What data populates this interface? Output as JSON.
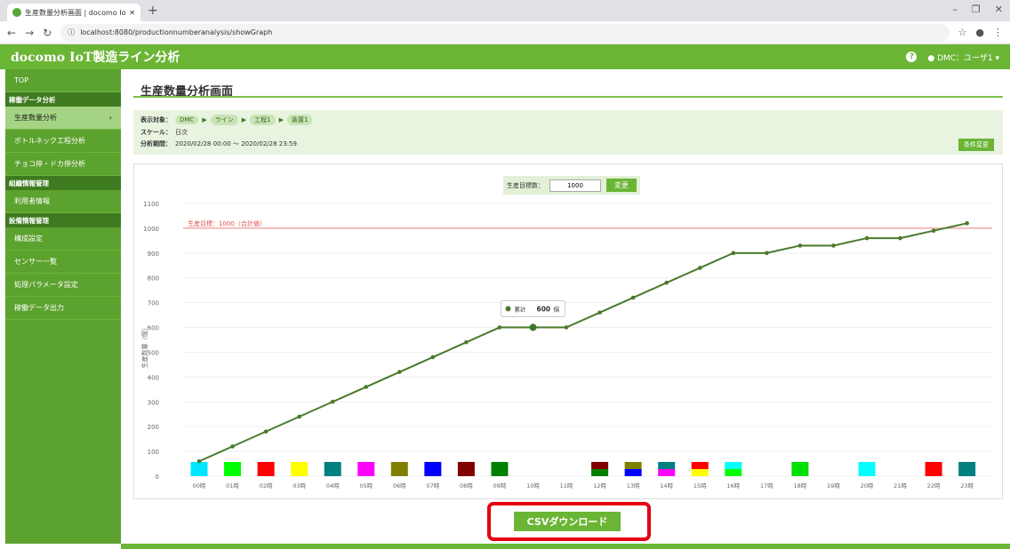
{
  "browser": {
    "tab_title": "生産数量分析画面 | docomo IoT",
    "url": "localhost:8080/productionnumberanalysis/showGraph"
  },
  "header": {
    "title": "docomo IoT製造ライン分析",
    "user": "DMC：ユーザ1"
  },
  "sidebar": {
    "top": "TOP",
    "sec_analysis": "稼働データ分析",
    "item_production": "生産数量分析",
    "item_bottleneck": "ボトルネック工程分析",
    "item_choko": "チョコ停・ドカ停分析",
    "sec_org": "組織情報管理",
    "item_users": "利用者情報",
    "sec_equipment": "設備情報管理",
    "item_config": "構成設定",
    "item_sensors": "センサー一覧",
    "item_params": "処理パラメータ設定",
    "item_output": "稼働データ出力"
  },
  "page": {
    "title": "生産数量分析画面",
    "target_label": "表示対象：",
    "breadcrumb": [
      "DMC",
      "ライン",
      "工程1",
      "装置1"
    ],
    "scale_label": "スケール：",
    "scale_value": "日次",
    "period_label": "分析期間：",
    "period_value": "2020/02/28 00:00 ～ 2020/02/28 23:59",
    "condition_button": "条件変更",
    "goal_label": "生産目標数：",
    "goal_value": "1000",
    "change_button": "変更",
    "csv_button": "CSVダウンロード"
  },
  "colors": {
    "accent": "#6bb535",
    "sidebar": "#5ca22e",
    "line": "#4b7a2b",
    "target": "#f08080",
    "highlight": "#e60012"
  },
  "chart_data": {
    "type": "line",
    "ylabel": "生産数量（個）",
    "ylim": [
      0,
      1100
    ],
    "yticks": [
      0,
      100,
      200,
      300,
      400,
      500,
      600,
      700,
      800,
      900,
      1000,
      1100
    ],
    "categories": [
      "00時",
      "01時",
      "02時",
      "03時",
      "04時",
      "05時",
      "06時",
      "07時",
      "08時",
      "09時",
      "10時",
      "11時",
      "12時",
      "13時",
      "14時",
      "15時",
      "16時",
      "17時",
      "18時",
      "19時",
      "20時",
      "21時",
      "22時",
      "23時"
    ],
    "series": [
      {
        "name": "累計",
        "values": [
          60,
          120,
          180,
          240,
          300,
          360,
          420,
          480,
          540,
          600,
          600,
          600,
          660,
          720,
          780,
          840,
          900,
          900,
          930,
          930,
          960,
          960,
          990,
          1020
        ]
      }
    ],
    "target": {
      "label": "生産目標：1000（合計値）",
      "value": 1000
    },
    "tooltip": {
      "label": "累計",
      "value": "600",
      "unit": "個",
      "index": 10
    },
    "status_bars": [
      [
        "#00e5ff"
      ],
      [
        "#00ff00"
      ],
      [
        "#ff0000"
      ],
      [
        "#ffff00"
      ],
      [
        "#008080"
      ],
      [
        "#ff00ff"
      ],
      [
        "#808000"
      ],
      [
        "#0000ff"
      ],
      [
        "#800000"
      ],
      [
        "#008000"
      ],
      [],
      [],
      [
        "#800000",
        "#008000"
      ],
      [
        "#808000",
        "#0000ff"
      ],
      [
        "#008080",
        "#ff00ff"
      ],
      [
        "#ff0000",
        "#ffff00"
      ],
      [
        "#00ffff",
        "#00ff00"
      ],
      [],
      [
        "#00e000"
      ],
      [],
      [
        "#00ffff"
      ],
      [],
      [
        "#ff0000"
      ],
      [
        "#008080"
      ]
    ]
  }
}
